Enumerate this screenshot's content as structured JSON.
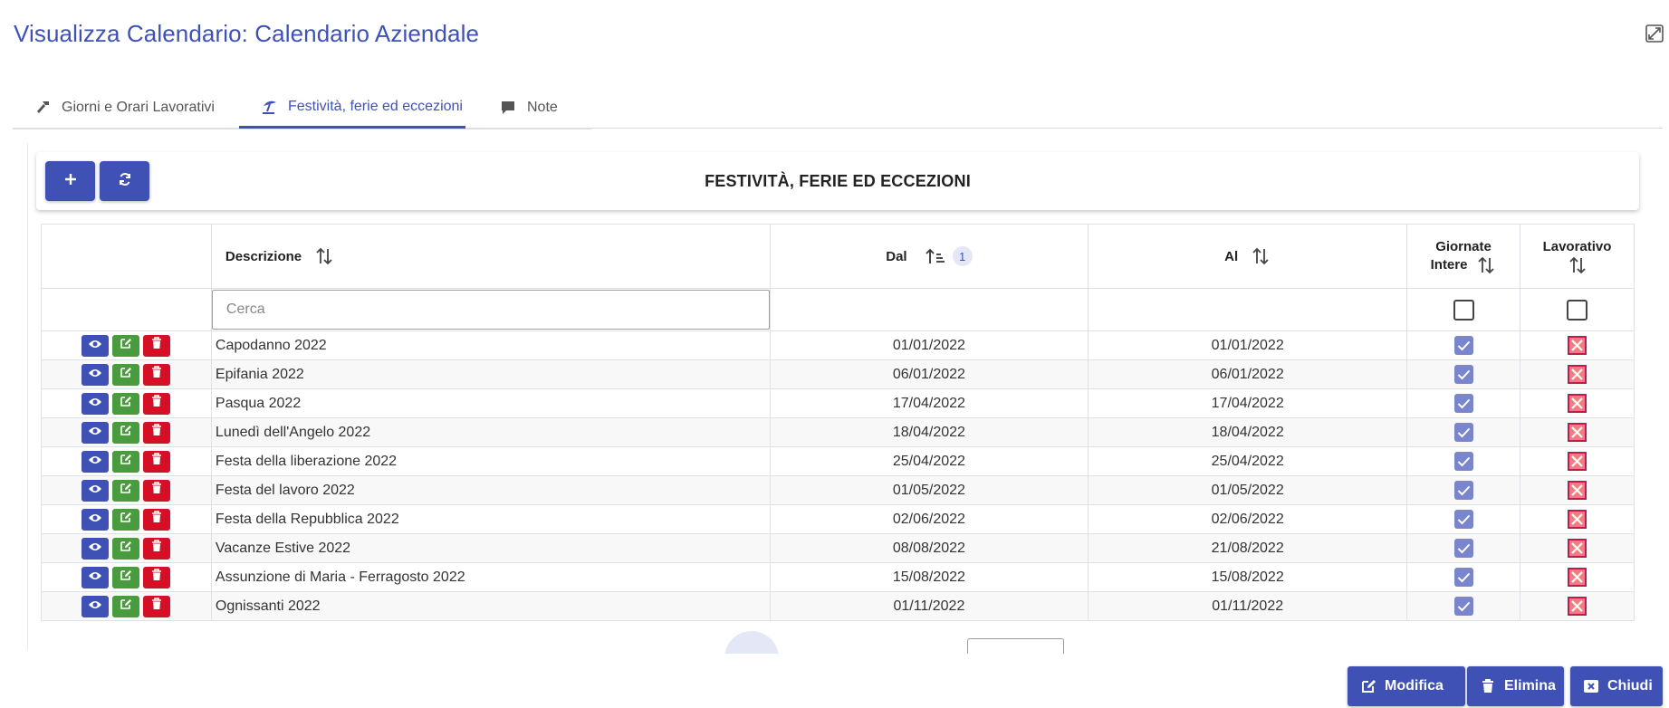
{
  "header": {
    "title": "Visualizza Calendario: Calendario Aziendale",
    "expand_icon": "expand-icon"
  },
  "tabs": [
    {
      "label": "Giorni e Orari Lavorativi",
      "icon": "hammer-icon",
      "active": false
    },
    {
      "label": "Festività, ferie ed eccezioni",
      "icon": "beach-umbrella-icon",
      "active": true
    },
    {
      "label": "Note",
      "icon": "comment-icon",
      "active": false
    }
  ],
  "toolbar": {
    "title": "FESTIVITÀ, FERIE ED ECCEZIONI",
    "add_icon": "plus-icon",
    "refresh_icon": "refresh-icon"
  },
  "table": {
    "columns": {
      "descrizione": "Descrizione",
      "dal": "Dal",
      "dal_sort_badge": "1",
      "al": "Al",
      "giornate_intere_line1": "Giornate",
      "giornate_intere_line2": "Intere",
      "lavorativo": "Lavorativo"
    },
    "search_placeholder": "Cerca",
    "rows": [
      {
        "descrizione": "Capodanno 2022",
        "dal": "01/01/2022",
        "al": "01/01/2022",
        "giornate_intere": true,
        "lavorativo": false
      },
      {
        "descrizione": "Epifania 2022",
        "dal": "06/01/2022",
        "al": "06/01/2022",
        "giornate_intere": true,
        "lavorativo": false
      },
      {
        "descrizione": "Pasqua 2022",
        "dal": "17/04/2022",
        "al": "17/04/2022",
        "giornate_intere": true,
        "lavorativo": false
      },
      {
        "descrizione": "Lunedì dell'Angelo 2022",
        "dal": "18/04/2022",
        "al": "18/04/2022",
        "giornate_intere": true,
        "lavorativo": false
      },
      {
        "descrizione": "Festa della liberazione 2022",
        "dal": "25/04/2022",
        "al": "25/04/2022",
        "giornate_intere": true,
        "lavorativo": false
      },
      {
        "descrizione": "Festa del lavoro 2022",
        "dal": "01/05/2022",
        "al": "01/05/2022",
        "giornate_intere": true,
        "lavorativo": false
      },
      {
        "descrizione": "Festa della Repubblica 2022",
        "dal": "02/06/2022",
        "al": "02/06/2022",
        "giornate_intere": true,
        "lavorativo": false
      },
      {
        "descrizione": "Vacanze Estive 2022",
        "dal": "08/08/2022",
        "al": "21/08/2022",
        "giornate_intere": true,
        "lavorativo": false
      },
      {
        "descrizione": "Assunzione di Maria - Ferragosto 2022",
        "dal": "15/08/2022",
        "al": "15/08/2022",
        "giornate_intere": true,
        "lavorativo": false
      },
      {
        "descrizione": "Ognissanti 2022",
        "dal": "01/11/2022",
        "al": "01/11/2022",
        "giornate_intere": true,
        "lavorativo": false
      }
    ]
  },
  "footer": {
    "modifica": "Modifica",
    "elimina": "Elimina",
    "chiudi": "Chiudi"
  },
  "colors": {
    "primary": "#3f51b5",
    "edit": "#4a9a3e",
    "delete": "#d50f25",
    "check": "#7986cb"
  }
}
